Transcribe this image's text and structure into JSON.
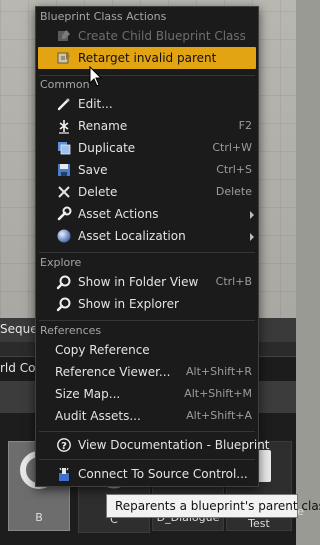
{
  "background": {
    "sequencer_label": "Sequen",
    "world_label": "rld Con",
    "assets": [
      {
        "label": "B"
      },
      {
        "label": "C"
      },
      {
        "label": "D_Dialogue"
      },
      {
        "label": "QG_Sequence Test"
      }
    ]
  },
  "menu": {
    "sections": {
      "blueprint": "Blueprint Class Actions",
      "common": "Common",
      "explore": "Explore",
      "references": "References"
    },
    "create_child": {
      "label": "Create Child Blueprint Class",
      "icon": "blueprint-icon"
    },
    "retarget": {
      "label": "Retarget invalid parent",
      "icon": "blueprint-retarget-icon"
    },
    "edit": {
      "label": "Edit...",
      "icon": "pencil-icon"
    },
    "rename": {
      "label": "Rename",
      "shortcut": "F2",
      "icon": "rename-icon"
    },
    "duplicate": {
      "label": "Duplicate",
      "shortcut": "Ctrl+W",
      "icon": "duplicate-icon"
    },
    "save": {
      "label": "Save",
      "shortcut": "Ctrl+S",
      "icon": "save-icon"
    },
    "delete": {
      "label": "Delete",
      "shortcut": "Delete",
      "icon": "delete-icon"
    },
    "asset_actions": {
      "label": "Asset Actions",
      "icon": "wrench-icon"
    },
    "asset_localization": {
      "label": "Asset Localization",
      "icon": "globe-icon"
    },
    "show_folder": {
      "label": "Show in Folder View",
      "shortcut": "Ctrl+B",
      "icon": "magnifier-icon"
    },
    "show_explorer": {
      "label": "Show in Explorer",
      "icon": "magnifier-icon"
    },
    "copy_reference": {
      "label": "Copy Reference"
    },
    "reference_viewer": {
      "label": "Reference Viewer...",
      "shortcut": "Alt+Shift+R"
    },
    "size_map": {
      "label": "Size Map...",
      "shortcut": "Alt+Shift+M"
    },
    "audit_assets": {
      "label": "Audit Assets...",
      "shortcut": "Alt+Shift+A"
    },
    "view_docs": {
      "label": "View Documentation - Blueprint",
      "icon": "help-icon"
    },
    "connect_source": {
      "label": "Connect To Source Control...",
      "icon": "source-control-icon"
    }
  },
  "tooltip": {
    "text": "Reparents a blueprint's parent class"
  },
  "colors": {
    "highlight": "#e3a413",
    "menu_bg": "#1b1b1b"
  }
}
